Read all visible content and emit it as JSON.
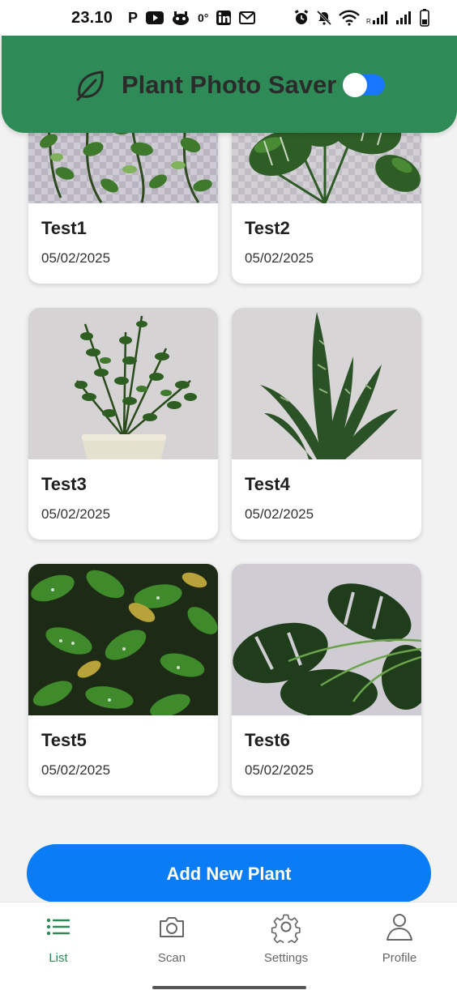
{
  "status_bar": {
    "time": "23.10",
    "left_icons": [
      "parking-icon",
      "youtube-icon",
      "mascot-icon",
      "temperature-icon",
      "linkedin-icon",
      "gmail-icon"
    ],
    "temperature": "0°",
    "right_icons": [
      "alarm-icon",
      "mute-icon",
      "wifi-icon",
      "signal-icon",
      "signal-icon",
      "battery-icon"
    ]
  },
  "header": {
    "title": "Plant Photo Saver",
    "icon": "leaf-icon",
    "toggle_on": true,
    "background": "#2e8b57"
  },
  "plants": [
    {
      "name": "Test1",
      "date": "05/02/2025"
    },
    {
      "name": "Test2",
      "date": "05/02/2025"
    },
    {
      "name": "Test3",
      "date": "05/02/2025"
    },
    {
      "name": "Test4",
      "date": "05/02/2025"
    },
    {
      "name": "Test5",
      "date": "05/02/2025"
    },
    {
      "name": "Test6",
      "date": "05/02/2025"
    }
  ],
  "add_button": {
    "label": "Add New Plant",
    "color": "#0a7cf5"
  },
  "nav": {
    "items": [
      {
        "label": "List",
        "icon": "list-icon",
        "active": true
      },
      {
        "label": "Scan",
        "icon": "camera-icon",
        "active": false
      },
      {
        "label": "Settings",
        "icon": "gear-icon",
        "active": false
      },
      {
        "label": "Profile",
        "icon": "user-icon",
        "active": false
      }
    ]
  }
}
